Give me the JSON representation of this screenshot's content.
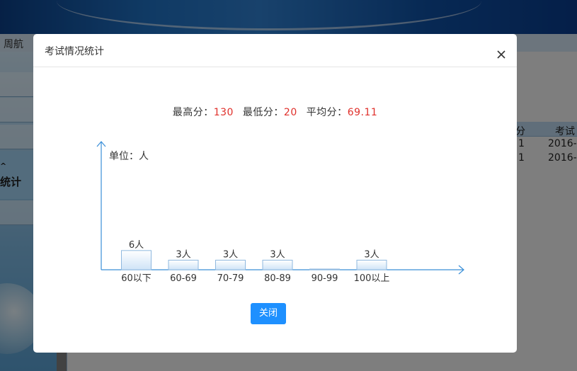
{
  "background": {
    "nav_text": "周航",
    "sidebar_label_1": "^",
    "sidebar_label_2": "统计",
    "table_headers": [
      "分",
      "考试"
    ],
    "table_rows": [
      [
        "1",
        "2016-"
      ],
      [
        "1",
        "2016-"
      ]
    ]
  },
  "dialog": {
    "title": "考试情况统计",
    "close_button_label": "关闭",
    "stats": {
      "max_label": "最高分：",
      "max_value": "130",
      "min_label": "最低分：",
      "min_value": "20",
      "avg_label": "平均分：",
      "avg_value": "69.11"
    },
    "colors": {
      "accent": "#1e90ff",
      "axis": "#3a8fd8",
      "highlight": "#e0302b",
      "bar_fill_top": "#ffffff",
      "bar_fill_bottom": "#cfe4f7",
      "bar_stroke": "#8fb8df"
    }
  },
  "chart_data": {
    "type": "bar",
    "unit_label": "单位：人",
    "categories": [
      "60以下",
      "60-69",
      "70-79",
      "80-89",
      "90-99",
      "100以上"
    ],
    "values": [
      6,
      3,
      3,
      3,
      0,
      3
    ],
    "value_labels": [
      "6人",
      "3人",
      "3人",
      "3人",
      "",
      "3人"
    ],
    "ylim": [
      0,
      40
    ]
  }
}
